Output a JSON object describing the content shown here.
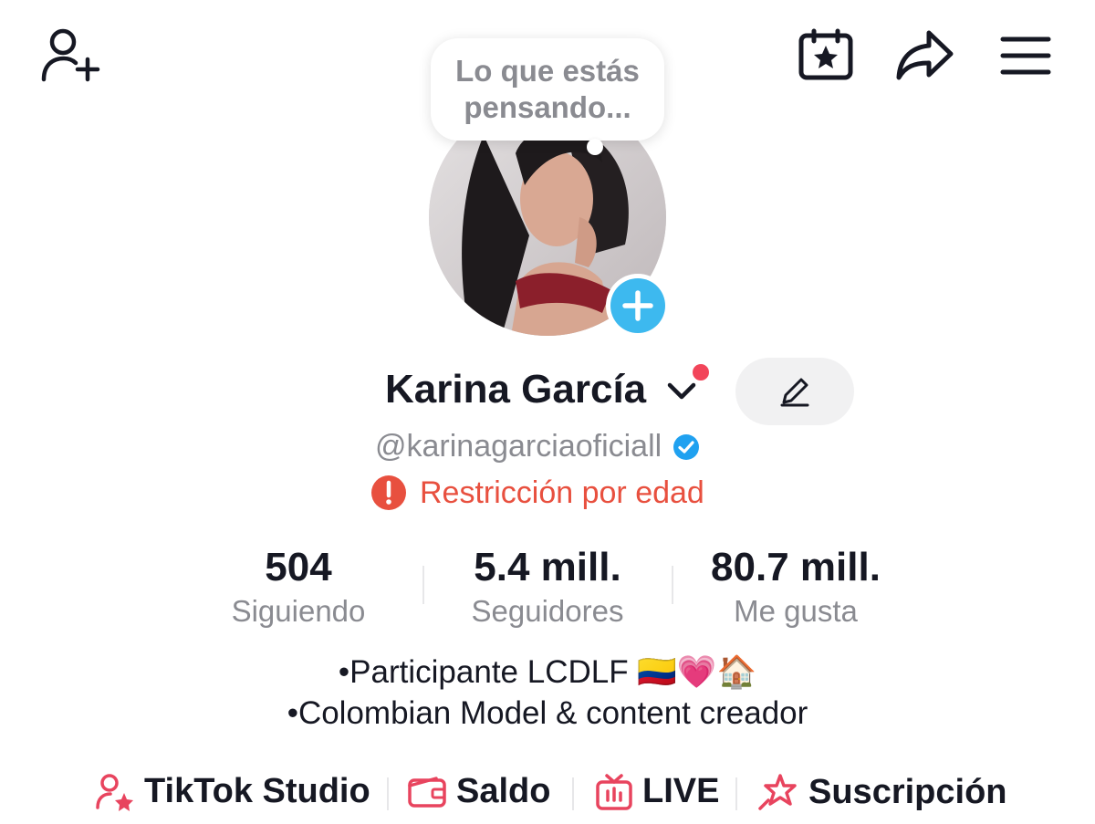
{
  "header": {
    "add_friend_icon": "person-plus-icon",
    "calendar_icon": "calendar-star-icon",
    "share_icon": "share-arrow-icon",
    "menu_icon": "hamburger-menu-icon"
  },
  "bubble": {
    "text_line1": "Lo que estás",
    "text_line2": "pensando..."
  },
  "profile": {
    "name": "Karina García",
    "handle": "@karinagarciaoficiall",
    "restriction": "Restricción por edad",
    "verified_color": "#20a1f0",
    "restriction_color": "#e8503f"
  },
  "stats": [
    {
      "value": "504",
      "label": "Siguiendo"
    },
    {
      "value": "5.4 mill.",
      "label": "Seguidores"
    },
    {
      "value": "80.7 mill.",
      "label": "Me gusta"
    }
  ],
  "bio": {
    "line1": "•Participante LCDLF 🇨🇴💗🏠",
    "line2": "•Colombian Model & content creador"
  },
  "tools": [
    {
      "label": "TikTok Studio",
      "icon": "creator-star-icon"
    },
    {
      "label": "Saldo",
      "icon": "wallet-icon"
    },
    {
      "label": "LIVE",
      "icon": "live-tv-icon"
    },
    {
      "label": "Suscripción",
      "icon": "subscription-star-icon"
    }
  ],
  "colors": {
    "accent": "#fe2c55",
    "story_add": "#3db9ef",
    "text_secondary": "#8a8b91"
  }
}
